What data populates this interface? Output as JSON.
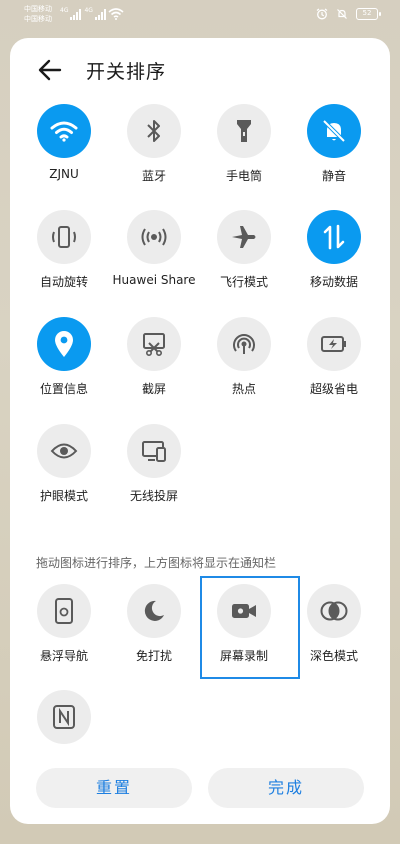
{
  "status_bar": {
    "carrier_1": "中国移动",
    "carrier_2": "中国移动",
    "sim1_tag": "4G",
    "sim2_tag": "4G",
    "battery": "52"
  },
  "header": {
    "title": "开关排序"
  },
  "active_toggles": [
    {
      "label": "ZJNU",
      "icon": "wifi-icon",
      "on": true
    },
    {
      "label": "蓝牙",
      "icon": "bluetooth-icon",
      "on": false
    },
    {
      "label": "手电筒",
      "icon": "flashlight-icon",
      "on": false
    },
    {
      "label": "静音",
      "icon": "bell-off-icon",
      "on": true
    },
    {
      "label": "自动旋转",
      "icon": "rotate-icon",
      "on": false
    },
    {
      "label": "Huawei Share",
      "icon": "share-icon",
      "on": false
    },
    {
      "label": "飞行模式",
      "icon": "airplane-icon",
      "on": false
    },
    {
      "label": "移动数据",
      "icon": "mobile-data-icon",
      "on": true
    },
    {
      "label": "位置信息",
      "icon": "location-icon",
      "on": true
    },
    {
      "label": "截屏",
      "icon": "screenshot-icon",
      "on": false
    },
    {
      "label": "热点",
      "icon": "hotspot-icon",
      "on": false
    },
    {
      "label": "超级省电",
      "icon": "battery-saver-icon",
      "on": false
    },
    {
      "label": "护眼模式",
      "icon": "eye-icon",
      "on": false
    },
    {
      "label": "无线投屏",
      "icon": "cast-icon",
      "on": false
    }
  ],
  "hint": "拖动图标进行排序，上方图标将显示在通知栏",
  "inactive_toggles": [
    {
      "label": "悬浮导航",
      "icon": "floating-nav-icon"
    },
    {
      "label": "免打扰",
      "icon": "moon-icon"
    },
    {
      "label": "屏幕录制",
      "icon": "video-record-icon"
    },
    {
      "label": "深色模式",
      "icon": "dark-mode-icon"
    },
    {
      "label": "",
      "icon": "nfc-icon"
    }
  ],
  "buttons": {
    "reset": "重置",
    "done": "完成"
  },
  "colors": {
    "accent": "#0a9af0",
    "button_text": "#1e7fe0",
    "highlight": "#1f8ae6"
  }
}
